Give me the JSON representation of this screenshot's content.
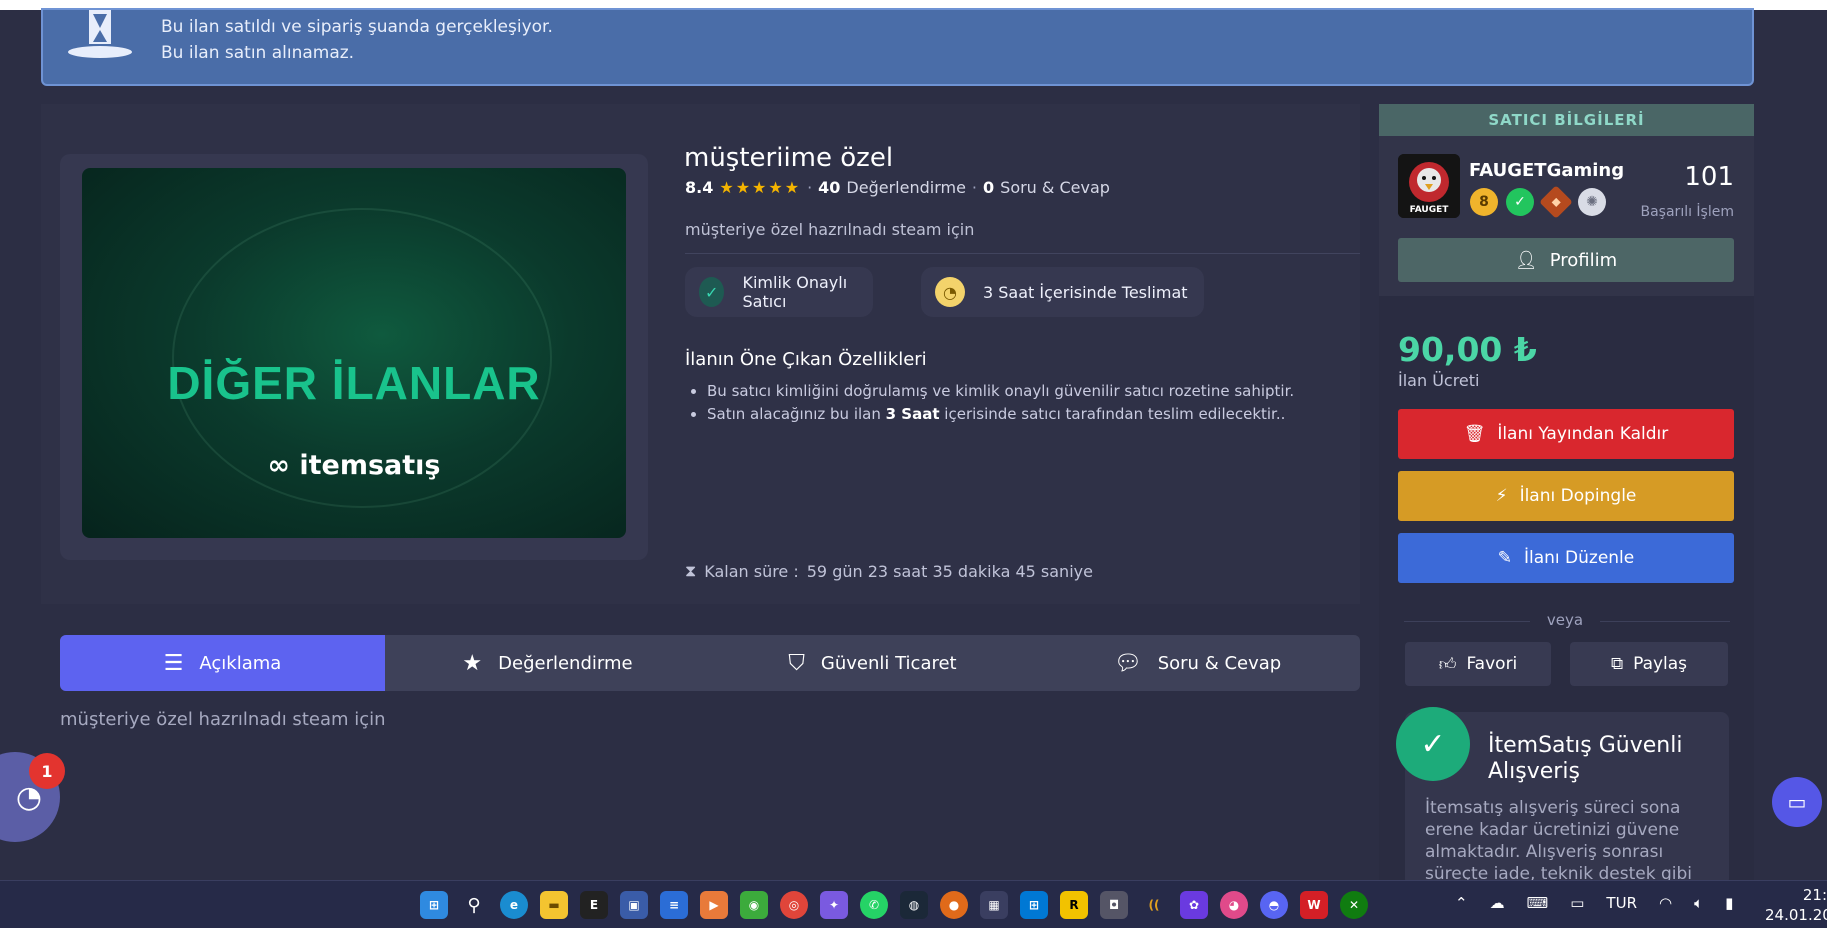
{
  "alert": {
    "line1": "Bu ilan satıldı ve sipariş şuanda gerçekleşiyor.",
    "line2": "Bu ilan satın alınamaz."
  },
  "listing": {
    "promo_title": "DİĞER İLANLAR",
    "promo_brand": "itemsatış",
    "title": "müşteriime özel",
    "rating": "8.4",
    "stars": "★★★★★",
    "review_count": "40",
    "review_label": "Değerlendirme",
    "qa_count": "0",
    "qa_label": "Soru & Cevap",
    "short_desc": "müşteriye özel hazrılnadı steam için",
    "badges": [
      {
        "label": "Kimlik Onaylı Satıcı",
        "icon": "shield-check-icon"
      },
      {
        "label": "3 Saat İçerisinde Teslimat",
        "icon": "stopwatch-icon"
      }
    ],
    "features_title": "İlanın Öne Çıkan Özellikleri",
    "feature1": "Bu satıcı kimliğini doğrulamış ve kimlik onaylı güvenilir satıcı rozetine sahiptir.",
    "feature2_pre": "Satın alacağınız bu ilan ",
    "feature2_bold": "3 Saat",
    "feature2_post": " içerisinde satıcı tarafından teslim edilecektir..",
    "remain_label": "Kalan süre :",
    "remain_value": "59 gün 23 saat 35 dakika 45 saniye"
  },
  "tabs": [
    {
      "label": "Açıklama",
      "icon": "lines-icon",
      "active": true
    },
    {
      "label": "Değerlendirme",
      "icon": "star-icon",
      "active": false
    },
    {
      "label": "Güvenli Ticaret",
      "icon": "shield-icon",
      "active": false
    },
    {
      "label": "Soru & Cevap",
      "icon": "chat-icon",
      "active": false
    }
  ],
  "description": "müşteriye özel hazrılnadı steam için",
  "chat": {
    "badge": "1"
  },
  "seller": {
    "header": "SATICI BİLGİLERİ",
    "name": "FAUGETGaming",
    "avatar_text": "FAUGET",
    "level": "8",
    "success_count": "101",
    "success_label": "Başarılı İşlem",
    "profile_button": "Profilim"
  },
  "price": {
    "value": "90,00 ₺",
    "label": "İlan Ücreti"
  },
  "actions": {
    "remove": "İlanı Yayından Kaldır",
    "boost": "İlanı Dopingle",
    "edit": "İlanı Düzenle",
    "or": "veya",
    "favorite": "Favori",
    "share": "Paylaş"
  },
  "safe": {
    "title": "İtemSatış Güvenli Alışveriş",
    "text": "İtemsatış alışveriş süreci sona erene kadar ücretinizi güvene almaktadır. Alışveriş sonrası süreçte iade, teknik destek gibi"
  },
  "taskbar": {
    "lang": "TUR",
    "time": "21:",
    "date": "24.01.20"
  },
  "colors": {
    "accent": "#5d63f0",
    "price": "#4bd6a6",
    "danger": "#d9272e",
    "warning": "#d69b25",
    "primary": "#3c6ad8"
  }
}
